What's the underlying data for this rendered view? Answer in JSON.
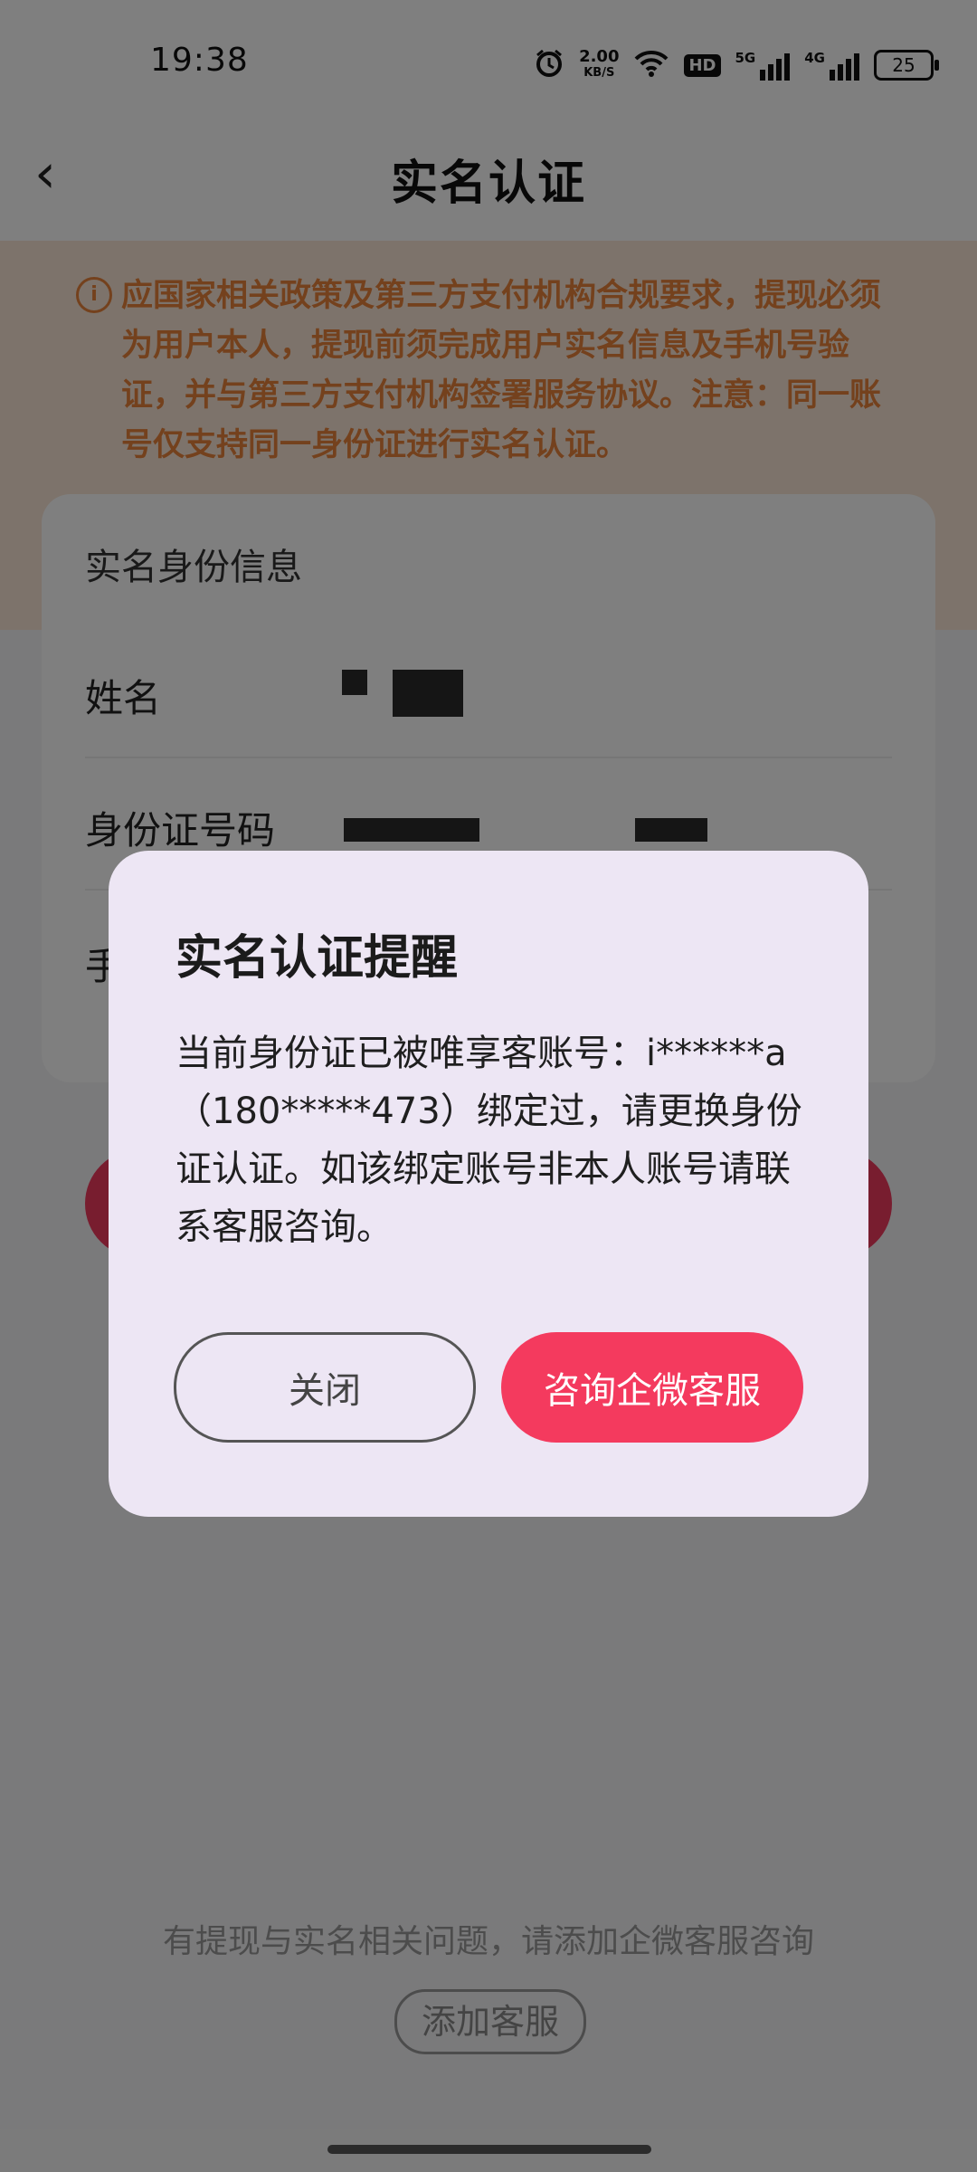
{
  "status_bar": {
    "time": "19:38",
    "net_speed_value": "2.00",
    "net_speed_unit": "KB/S",
    "hd_label": "HD",
    "signal1_label": "5G",
    "signal2_label": "4G",
    "battery": "25"
  },
  "nav": {
    "back_glyph": "‹",
    "title": "实名认证"
  },
  "notice": {
    "icon_glyph": "i",
    "text": "应国家相关政策及第三方支付机构合规要求，提现必须为用户本人，提现前须完成用户实名信息及手机号验证，并与第三方支付机构签署服务协议。注意：同一账号仅支持同一身份证进行实名认证。"
  },
  "identity_card": {
    "title": "实名身份信息",
    "name_label": "姓名",
    "id_label": "身份证号码",
    "phone_label_partial": "手"
  },
  "footer": {
    "help_text": "有提现与实名相关问题，请添加企微客服咨询",
    "add_service_label": "添加客服"
  },
  "dialog": {
    "title": "实名认证提醒",
    "body": "当前身份证已被唯享客账号：i******a（180*****473）绑定过，请更换身份证认证。如该绑定账号非本人账号请联系客服咨询。",
    "close_label": "关闭",
    "consult_label": "咨询企微客服"
  },
  "colors": {
    "notice_text": "#e8833a",
    "notice_bg": "#fbe6d7",
    "accent": "#f43a5e",
    "dialog_bg": "#ede6f4"
  }
}
